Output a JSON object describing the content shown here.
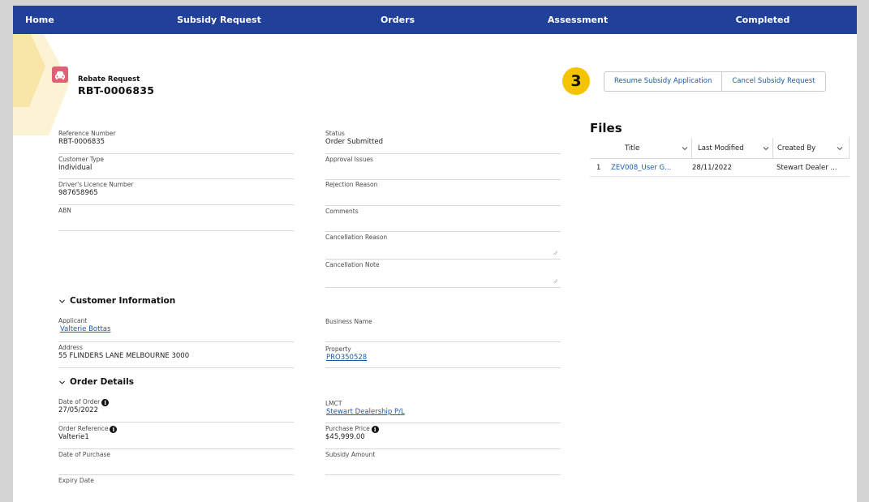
{
  "nav": {
    "items": [
      "Home",
      "Subsidy Request",
      "Orders",
      "Assessment",
      "Completed"
    ]
  },
  "record": {
    "icon": "car-icon",
    "type_label": "Rebate Request",
    "name": "RBT-0006835"
  },
  "badge": "3",
  "actions": {
    "resume": "Resume Subsidy Application",
    "cancel": "Cancel Subsidy Request"
  },
  "details": {
    "left": [
      {
        "label": "Reference Number",
        "value": "RBT-0006835"
      },
      {
        "label": "Customer Type",
        "value": "Individual"
      },
      {
        "label": "Driver's Licence Number",
        "value": "987658965"
      },
      {
        "label": "ABN",
        "value": ""
      }
    ],
    "right": [
      {
        "label": "Status",
        "value": "Order Submitted"
      },
      {
        "label": "Approval Issues",
        "value": ""
      },
      {
        "label": "Rejection Reason",
        "value": ""
      },
      {
        "label": "Comments",
        "value": ""
      },
      {
        "label": "Cancellation Reason",
        "value": ""
      },
      {
        "label": "Cancellation Note",
        "value": ""
      }
    ]
  },
  "customer_info": {
    "title": "Customer Information",
    "applicant_label": "Applicant",
    "applicant_value": "Valterie Bottas",
    "business_label": "Business Name",
    "business_value": "",
    "address_label": "Address",
    "address_value": "55 FLINDERS LANE MELBOURNE 3000",
    "property_label": "Property",
    "property_value": "PRO350528"
  },
  "order_details": {
    "title": "Order Details",
    "date_of_order_label": "Date of Order",
    "date_of_order_value": "27/05/2022",
    "lmct_label": "LMCT",
    "lmct_value": "Stewart Dealership P/L",
    "order_ref_label": "Order Reference",
    "order_ref_value": "Valterie1",
    "purchase_price_label": "Purchase Price",
    "purchase_price_value": "$45,999.00",
    "date_of_purchase_label": "Date of Purchase",
    "date_of_purchase_value": "",
    "subsidy_amount_label": "Subsidy Amount",
    "subsidy_amount_value": "",
    "expiry_date_label": "Expiry Date",
    "expiry_date_value": ""
  },
  "files": {
    "title": "Files",
    "columns": [
      "Title",
      "Last Modified",
      "Created By"
    ],
    "rows": [
      {
        "num": "1",
        "title": "ZEV008_User G...",
        "modified": "28/11/2022",
        "created_by": "Stewart Dealer ..."
      }
    ]
  },
  "colors": {
    "nav_bg": "#21409a",
    "link": "#1b5aa8",
    "badge": "#f5c400",
    "record_icon": "#e06075"
  }
}
